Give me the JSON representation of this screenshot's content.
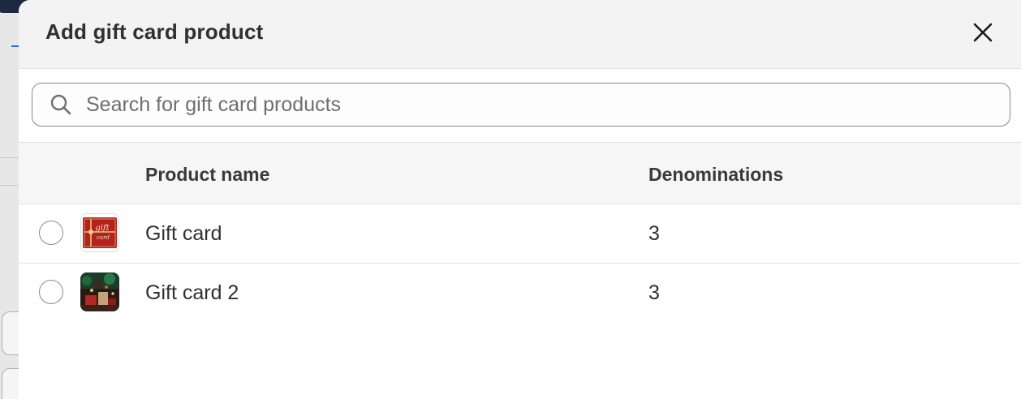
{
  "modal": {
    "title": "Add gift card product",
    "close_icon": "close-icon"
  },
  "search": {
    "placeholder": "Search for gift card products",
    "value": "",
    "icon": "search-icon"
  },
  "table": {
    "headers": {
      "product_name": "Product name",
      "denominations": "Denominations"
    },
    "rows": [
      {
        "name": "Gift card",
        "denominations": "3",
        "thumbnail_text": "gift card"
      },
      {
        "name": "Gift card 2",
        "denominations": "3"
      }
    ]
  },
  "colors": {
    "header_bg": "#f3f3f3",
    "text": "#303030",
    "thumb_red": "#b3221c"
  }
}
